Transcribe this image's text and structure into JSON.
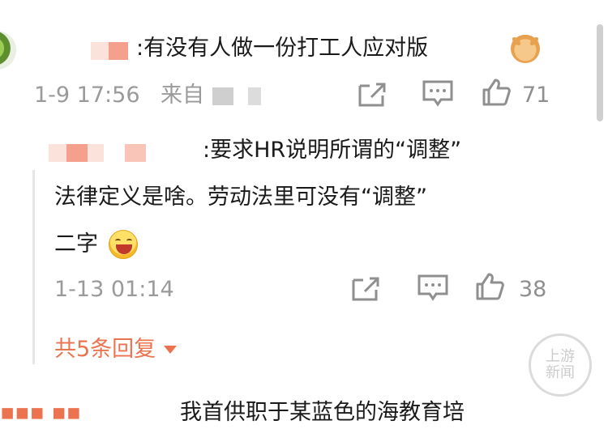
{
  "comment": {
    "text": ":有没有人做一份打工人应对版",
    "time": "1-9 17:56",
    "source_prefix": "来自",
    "likes": "71"
  },
  "reply": {
    "line1": ":要求HR说明所谓的“调整”",
    "line2": "法律定义是啥。劳动法里可没有“调整”",
    "line3": "二字",
    "time": "1-13 01:14",
    "likes": "38"
  },
  "more_replies": "共5条回复",
  "watermark": {
    "line1": "上游",
    "line2": "新闻"
  },
  "bottom_partial": {
    "left": "▪▪▪ ▪▪",
    "text": "我首供职于某蓝色的海教育培"
  },
  "colors": {
    "accent_orange": "#eb7350",
    "meta_gray": "#9a9a9a",
    "mosaic_pink": "#f4a08c"
  },
  "icons": [
    "share-icon",
    "comment-icon",
    "like-icon",
    "caret-down-icon",
    "laugh-emoji",
    "doge-emoji"
  ]
}
